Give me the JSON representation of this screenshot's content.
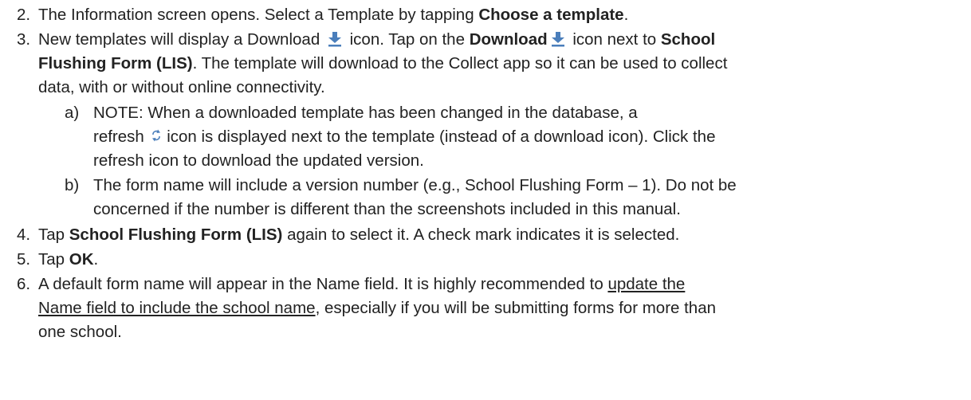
{
  "steps": {
    "s2": {
      "num": "2.",
      "text_a": "The Information screen opens.  Select a Template by tapping ",
      "bold_a": "Choose a template",
      "text_b": "."
    },
    "s3": {
      "num": "3.",
      "line1_a": "New templates will display a Download ",
      "line1_b": " icon.  Tap on the ",
      "line1_bold1": "Download",
      "line1_c": " icon next to ",
      "line1_bold2": "School",
      "line2_bold": "Flushing Form (LIS)",
      "line2_text": ".  The template will download to the Collect app so it can be used to collect",
      "line3_text": "data, with or without online connectivity.",
      "sub_a": {
        "label": "a)",
        "line1": "NOTE: When a downloaded template has been changed in the database, a",
        "line2_a": "refresh ",
        "line2_b": " icon is displayed next to the template (instead of a download icon).  Click the",
        "line3": "refresh icon to download the updated version."
      },
      "sub_b": {
        "label": "b)",
        "line1": "The form name will include a version number (e.g., School Flushing Form – 1).  Do not be",
        "line2": "concerned if the number is different than the screenshots included in this manual."
      }
    },
    "s4": {
      "num": "4.",
      "text_a": "Tap ",
      "bold_a": "School Flushing Form (LIS)",
      "text_b": " again to select it.  A check mark indicates it is selected."
    },
    "s5": {
      "num": "5.",
      "text_a": "Tap ",
      "bold_a": "OK",
      "text_b": "."
    },
    "s6": {
      "num": "6.",
      "line1_a": "A default form name will appear in the Name field.  It is highly recommended to ",
      "line1_u": "update the",
      "line2_u": "Name field to include the school name",
      "line2_b": ", especially if you will be submitting forms for more than",
      "line3": "one school."
    }
  },
  "icons": {
    "download": "download-arrow-icon",
    "refresh": "refresh-cycle-icon",
    "download_color": "#4a7ebb",
    "refresh_color": "#4a7ebb"
  }
}
